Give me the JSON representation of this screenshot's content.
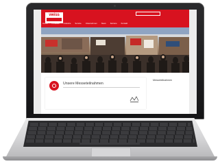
{
  "brand": {
    "logo_text": "weiss",
    "accent": "#d8121f"
  },
  "header": {
    "links": [
      "",
      ""
    ]
  },
  "nav": {
    "items": [
      "Home",
      "Produkte",
      "Industrie",
      "Service",
      "Unternehmen",
      "News",
      "Karriere",
      "Kontakt"
    ]
  },
  "breadcrumb": "",
  "content": {
    "title": "Unsere Messeteilnahmen",
    "event_name": "",
    "date_label": "",
    "date_value": ""
  },
  "sidebar": {
    "title": "Messeteilnahmen",
    "links": [
      "",
      ""
    ]
  }
}
